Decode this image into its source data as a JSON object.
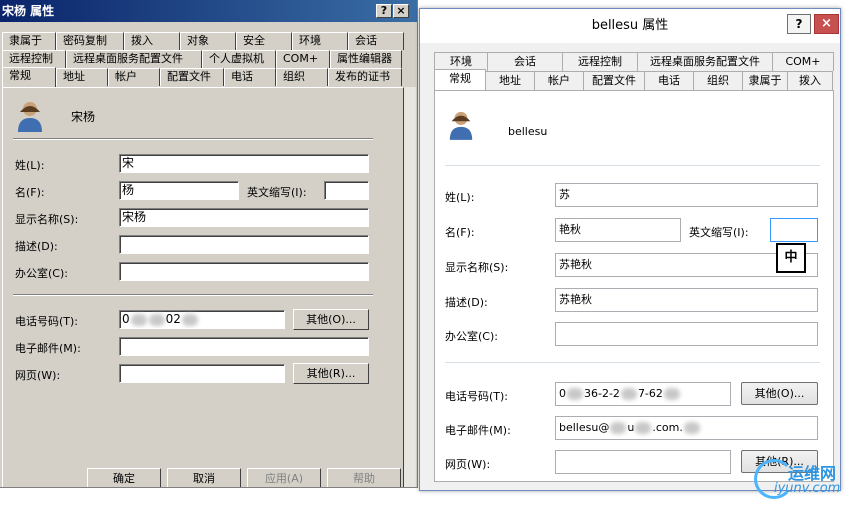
{
  "left": {
    "title": "宋杨 属性",
    "help": "?",
    "close": "×",
    "tabs_row1": [
      "隶属于",
      "密码复制",
      "拨入",
      "对象",
      "安全",
      "环境",
      "会话"
    ],
    "tabs_row2": [
      "远程控制",
      "远程桌面服务配置文件",
      "个人虚拟机",
      "COM+",
      "属性编辑器"
    ],
    "tabs_row3": [
      "常规",
      "地址",
      "帐户",
      "配置文件",
      "电话",
      "组织",
      "发布的证书"
    ],
    "display_name_header": "宋杨",
    "fields": {
      "last_name_label": "姓(L):",
      "last_name_value": "宋",
      "first_name_label": "名(F):",
      "first_name_value": "杨",
      "initials_label": "英文缩写(I):",
      "initials_value": "",
      "display_name_label": "显示名称(S):",
      "display_name_value": "宋杨",
      "description_label": "描述(D):",
      "description_value": "",
      "office_label": "办公室(C):",
      "office_value": "",
      "phone_label": "电话号码(T):",
      "phone_value_a": "0",
      "phone_value_b": "02",
      "email_label": "电子邮件(M):",
      "email_value": "",
      "webpage_label": "网页(W):",
      "webpage_value": ""
    },
    "other_phone_btn": "其他(O)...",
    "other_web_btn": "其他(R)...",
    "ok_btn": "确定",
    "cancel_btn": "取消",
    "apply_btn": "应用(A)",
    "help_btn": "帮助"
  },
  "right": {
    "title": "bellesu 属性",
    "help": "?",
    "close": "×",
    "tabs_row1": [
      "环境",
      "会话",
      "远程控制",
      "远程桌面服务配置文件",
      "COM+"
    ],
    "tabs_row2": [
      "常规",
      "地址",
      "帐户",
      "配置文件",
      "电话",
      "组织",
      "隶属于",
      "拨入"
    ],
    "display_name_header": "bellesu",
    "fields": {
      "last_name_label": "姓(L):",
      "last_name_value": "苏",
      "first_name_label": "名(F):",
      "first_name_value": "艳秋",
      "initials_label": "英文缩写(I):",
      "initials_value": "",
      "display_name_label": "显示名称(S):",
      "display_name_value": "苏艳秋",
      "description_label": "描述(D):",
      "description_value": "苏艳秋",
      "office_label": "办公室(C):",
      "office_value": "",
      "phone_label": "电话号码(T):",
      "phone_value_a": "0",
      "phone_value_b": "36-2-2",
      "phone_value_c": "7-62",
      "email_label": "电子邮件(M):",
      "email_value_a": "bellesu@",
      "email_value_b": "u",
      "email_value_c": ".com.",
      "webpage_label": "网页(W):",
      "webpage_value": ""
    },
    "ime_indicator": "中",
    "other_phone_btn": "其他(O)...",
    "other_web_btn": "其他(R)..."
  },
  "watermark": {
    "cn": "运维网",
    "en": "iyunv.com"
  }
}
